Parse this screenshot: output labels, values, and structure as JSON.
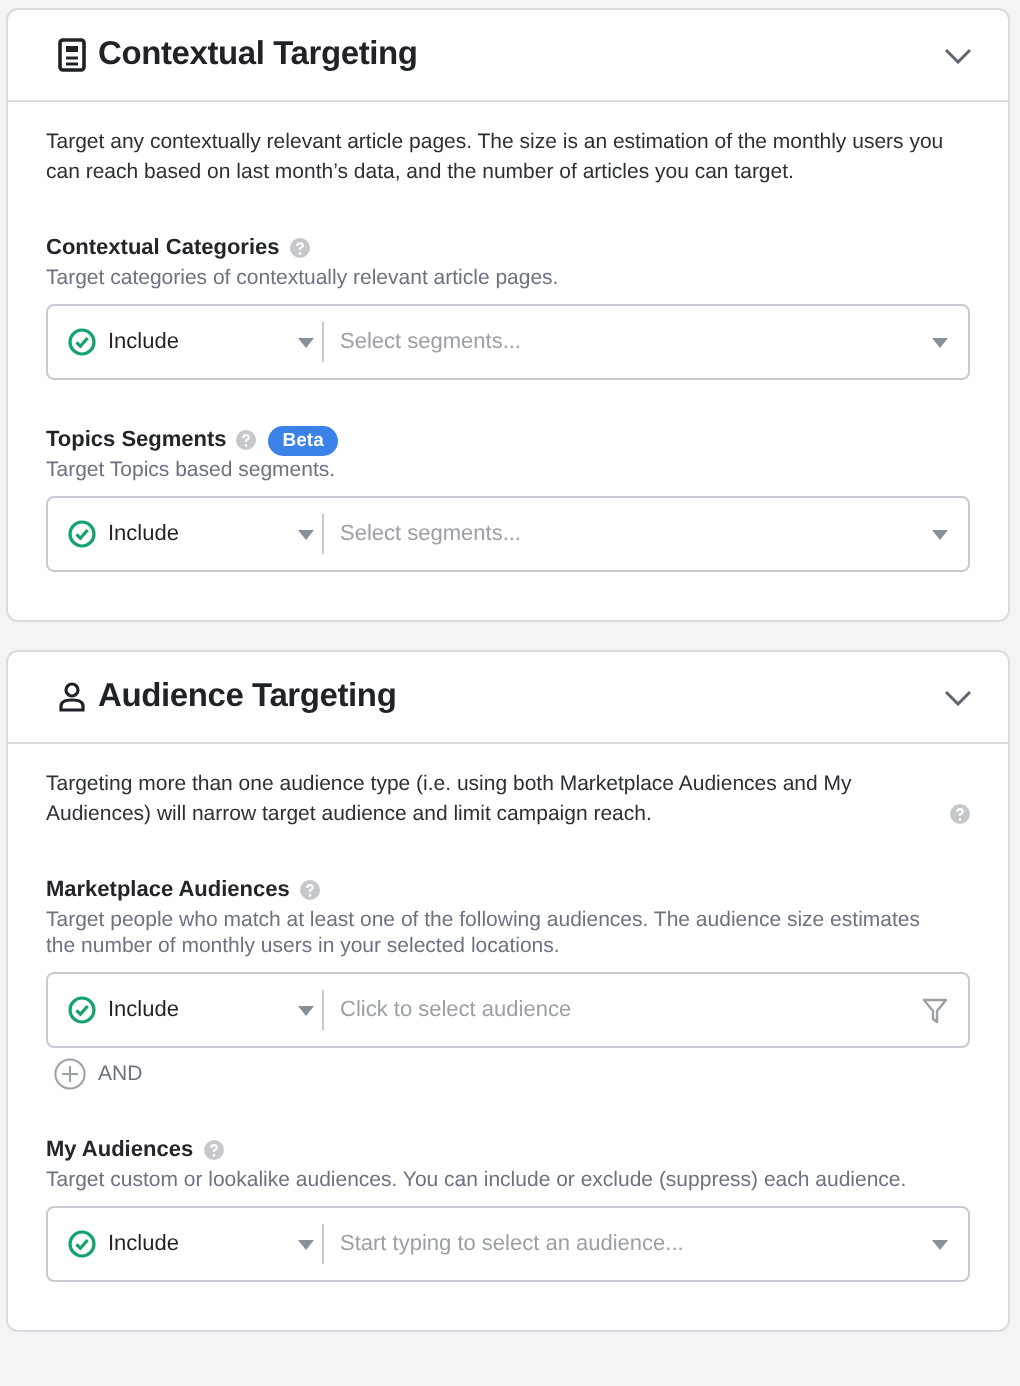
{
  "sections": [
    {
      "title": "Contextual Targeting",
      "expanded": true,
      "intro": "Target any contextually relevant article pages. The size is an estimation of the monthly users you can reach based on last month’s data, and the number of articles you can target.",
      "fields": [
        {
          "kind": "dropdown",
          "label": "Contextual Categories",
          "description": "Target categories of contextually relevant article pages.",
          "mode": "Include",
          "placeholder": "Select segments..."
        },
        {
          "kind": "dropdown",
          "label": "Topics Segments",
          "badge": "Beta",
          "description": "Target Topics based segments.",
          "mode": "Include",
          "placeholder": "Select segments..."
        }
      ]
    },
    {
      "title": "Audience Targeting",
      "expanded": true,
      "intro": "Targeting more than one audience type (i.e. using both Marketplace Audiences and My Audiences) will narrow target audience and limit campaign reach.",
      "intro_help": true,
      "fields": [
        {
          "kind": "filter",
          "label": "Marketplace Audiences",
          "description": "Target people who match at least one of the following audiences. The audience size estimates the number of monthly users in your selected locations.",
          "mode": "Include",
          "placeholder": "Click to select audience",
          "and_button": "AND"
        },
        {
          "kind": "dropdown",
          "label": "My Audiences",
          "description": "Target custom or lookalike audiences. You can include or exclude (suppress) each audience.",
          "mode": "Include",
          "placeholder": "Start typing to select an audience..."
        }
      ]
    }
  ]
}
